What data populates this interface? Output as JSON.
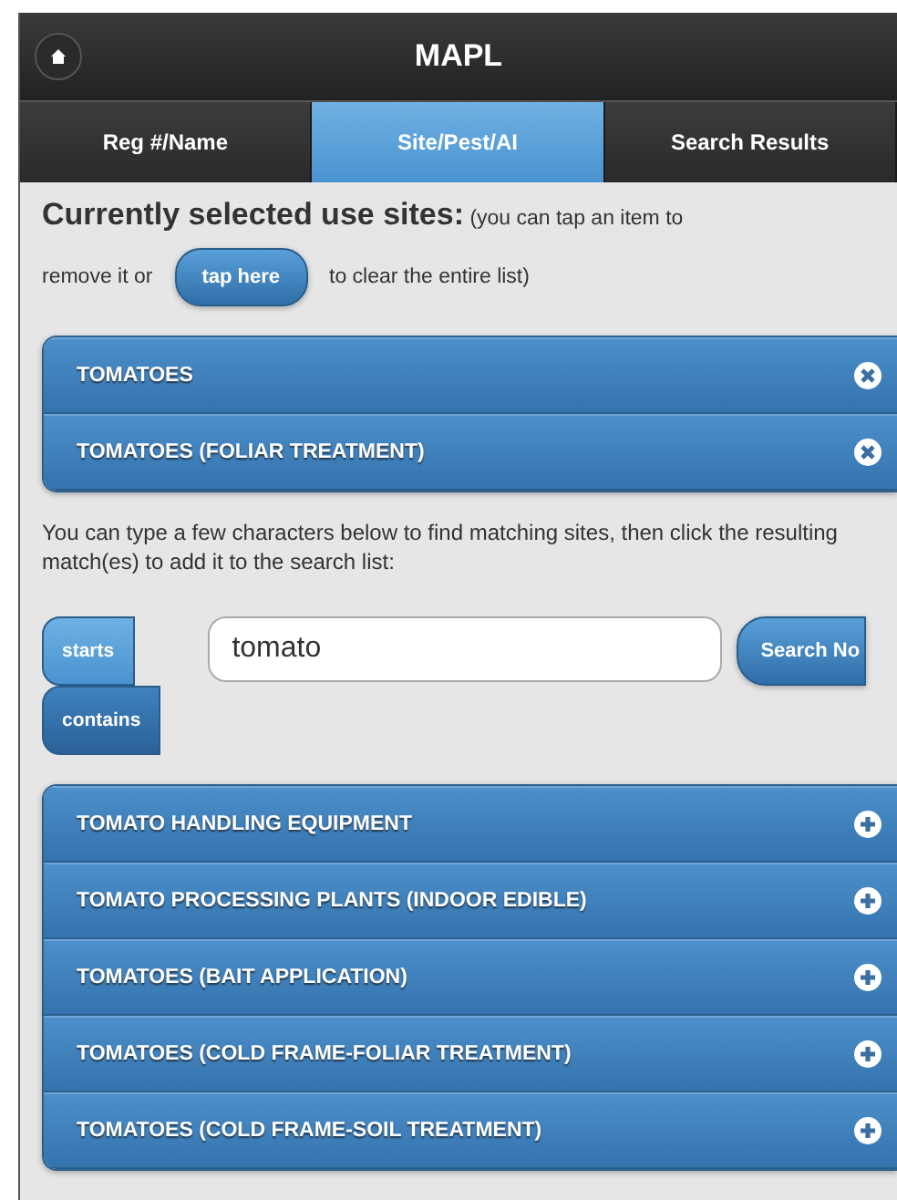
{
  "header": {
    "title": "MAPL"
  },
  "tabs": [
    {
      "label": "Reg #/Name",
      "selected": false
    },
    {
      "label": "Site/Pest/AI",
      "selected": true
    },
    {
      "label": "Search Results",
      "selected": false
    }
  ],
  "selected_sites": {
    "heading": "Currently selected use sites:",
    "note_start": "(you can tap an item to",
    "note_before": "remove it or",
    "clear_button": "tap here",
    "note_after": "to clear the entire list)",
    "items": [
      {
        "label": "TOMATOES"
      },
      {
        "label": "TOMATOES (FOLIAR TREATMENT)"
      }
    ]
  },
  "instructions": "You can type a few characters below to find matching sites, then click the resulting match(es) to add it to the search list:",
  "match_modes": [
    {
      "label": "starts",
      "selected": true
    },
    {
      "label": "contains",
      "selected": false
    }
  ],
  "search": {
    "value": "tomato",
    "button": "Search No"
  },
  "results": [
    {
      "label": "TOMATO HANDLING EQUIPMENT"
    },
    {
      "label": "TOMATO PROCESSING PLANTS (INDOOR EDIBLE)"
    },
    {
      "label": "TOMATOES (BAIT APPLICATION)"
    },
    {
      "label": "TOMATOES (COLD FRAME-FOLIAR TREATMENT)"
    },
    {
      "label": "TOMATOES (COLD FRAME-SOIL TREATMENT)"
    }
  ]
}
